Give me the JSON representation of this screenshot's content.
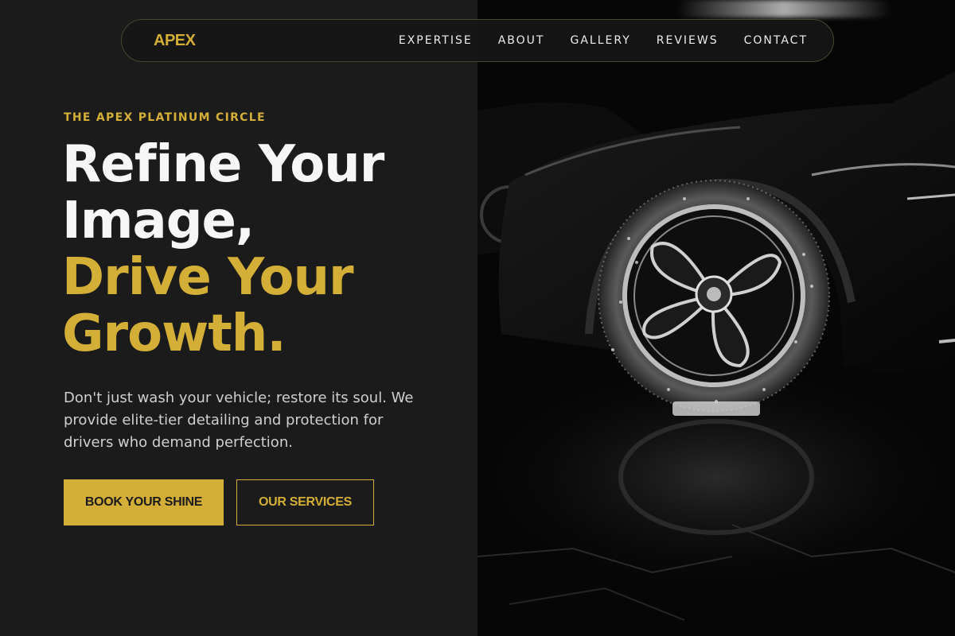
{
  "nav": {
    "logo": "APEX",
    "links": [
      "EXPERTISE",
      "ABOUT",
      "GALLERY",
      "REVIEWS",
      "CONTACT"
    ]
  },
  "hero": {
    "eyebrow": "THE APEX PLATINUM CIRCLE",
    "headline_line1": "Refine Your",
    "headline_line2": "Image,",
    "headline_line3": "Drive Your",
    "headline_line4": "Growth.",
    "description": "Don't just wash your vehicle; restore its soul. We provide elite-tier detailing and protection for drivers who demand perfection.",
    "primary_button": "BOOK YOUR SHINE",
    "secondary_button": "OUR SERVICES"
  },
  "image": {
    "subject": "black-car-wheel-with-foam-icon"
  },
  "colors": {
    "accent": "#d4af37",
    "background": "#1b1b1b",
    "text_light": "#f6f6f6",
    "text_muted": "#cfcfcf"
  }
}
